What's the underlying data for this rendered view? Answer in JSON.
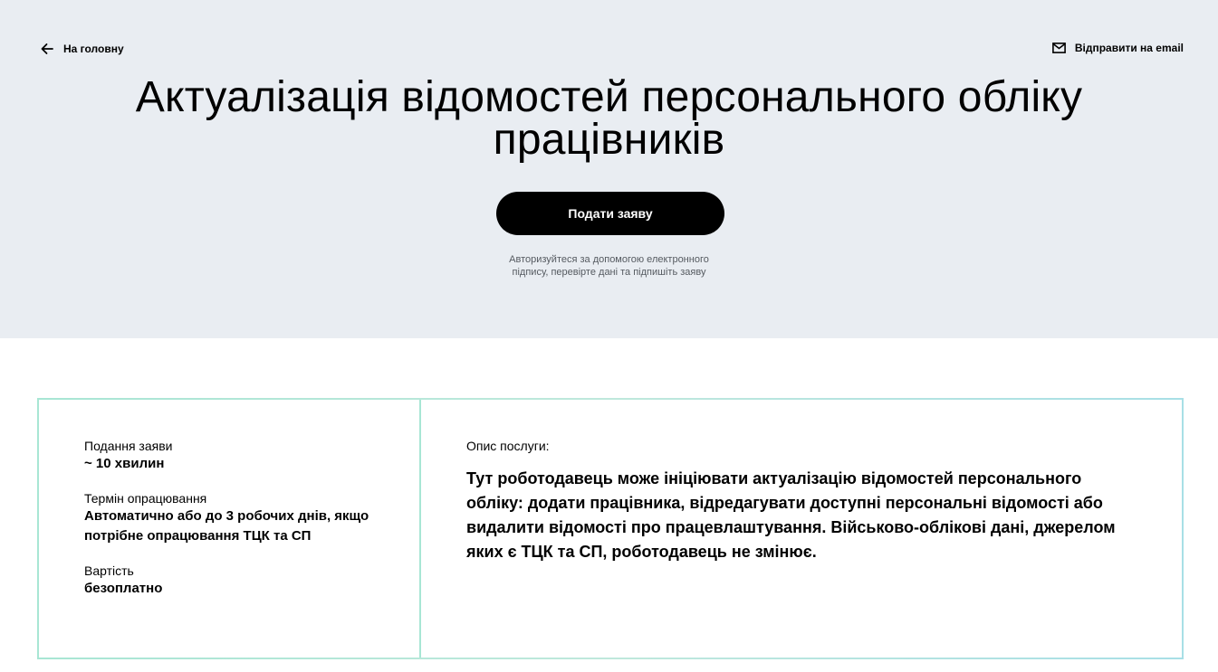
{
  "header": {
    "back_label": "На головну",
    "email_label": "Відправити на email"
  },
  "hero": {
    "title_line1": "Актуалізація відомостей персонального обліку",
    "title_line2": "працівників",
    "submit_label": "Подати заяву",
    "hint_line1": "Авторизуйтеся за допомогою електронного",
    "hint_line2": "підпису, перевірте дані та підпишіть заяву"
  },
  "info": {
    "items": [
      {
        "label": "Подання заяви",
        "value": "~ 10 хвилин"
      },
      {
        "label": "Термін опрацювання",
        "value": "Автоматично або до 3 робочих днів, якщо потрібне опрацювання ТЦК та СП"
      },
      {
        "label": "Вартість",
        "value": "безоплатно"
      }
    ]
  },
  "description": {
    "label": "Опис послуги:",
    "text": "Тут роботодавець може ініціювати актуалізацію відомостей персонального обліку: додати працівника, відредагувати доступні персональні відомості або видалити відомості про працевлаштування. Військово-облікові дані, джерелом яких є ТЦК та СП, роботодавець не змінює."
  },
  "icons": {
    "back": "arrow-left-icon",
    "email": "envelope-icon"
  },
  "colors": {
    "hero_bg": "#e9edf2",
    "button_bg": "#000000",
    "card_border": "#a8e6d4"
  }
}
